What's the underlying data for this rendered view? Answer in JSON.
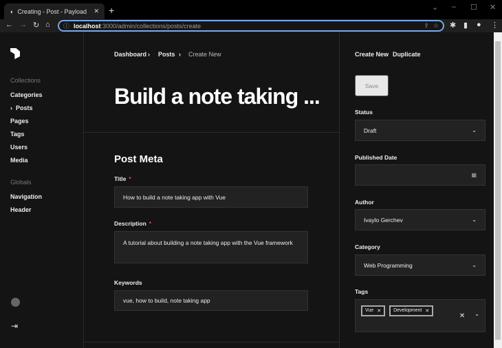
{
  "browser": {
    "tab_title": "Creating - Post - Payload",
    "url_host": "localhost",
    "url_rest": ":3000/admin/collections/posts/create"
  },
  "sidebar": {
    "collections_label": "Collections",
    "collections": [
      "Categories",
      "Posts",
      "Pages",
      "Tags",
      "Users",
      "Media"
    ],
    "active": "Posts",
    "globals_label": "Globals",
    "globals": [
      "Navigation",
      "Header"
    ]
  },
  "breadcrumb": [
    "Dashboard",
    "Posts",
    "Create New"
  ],
  "title": "Build a note taking ...",
  "section": "Post Meta",
  "fields": {
    "title_label": "Title",
    "title_value": "How to build a note taking app with Vue",
    "description_label": "Description",
    "description_value": "A tutorial about building a note taking app with the Vue framework",
    "keywords_label": "Keywords",
    "keywords_value": "vue, how to build, note taking app"
  },
  "actions": {
    "create_new": "Create New",
    "duplicate": "Duplicate",
    "save": "Save"
  },
  "side": {
    "status_label": "Status",
    "status_value": "Draft",
    "date_label": "Published Date",
    "date_value": "",
    "author_label": "Author",
    "author_value": "Ivaylo Gerchev",
    "category_label": "Category",
    "category_value": "Web Programming",
    "tags_label": "Tags",
    "tags": [
      "Vue",
      "Development"
    ]
  }
}
